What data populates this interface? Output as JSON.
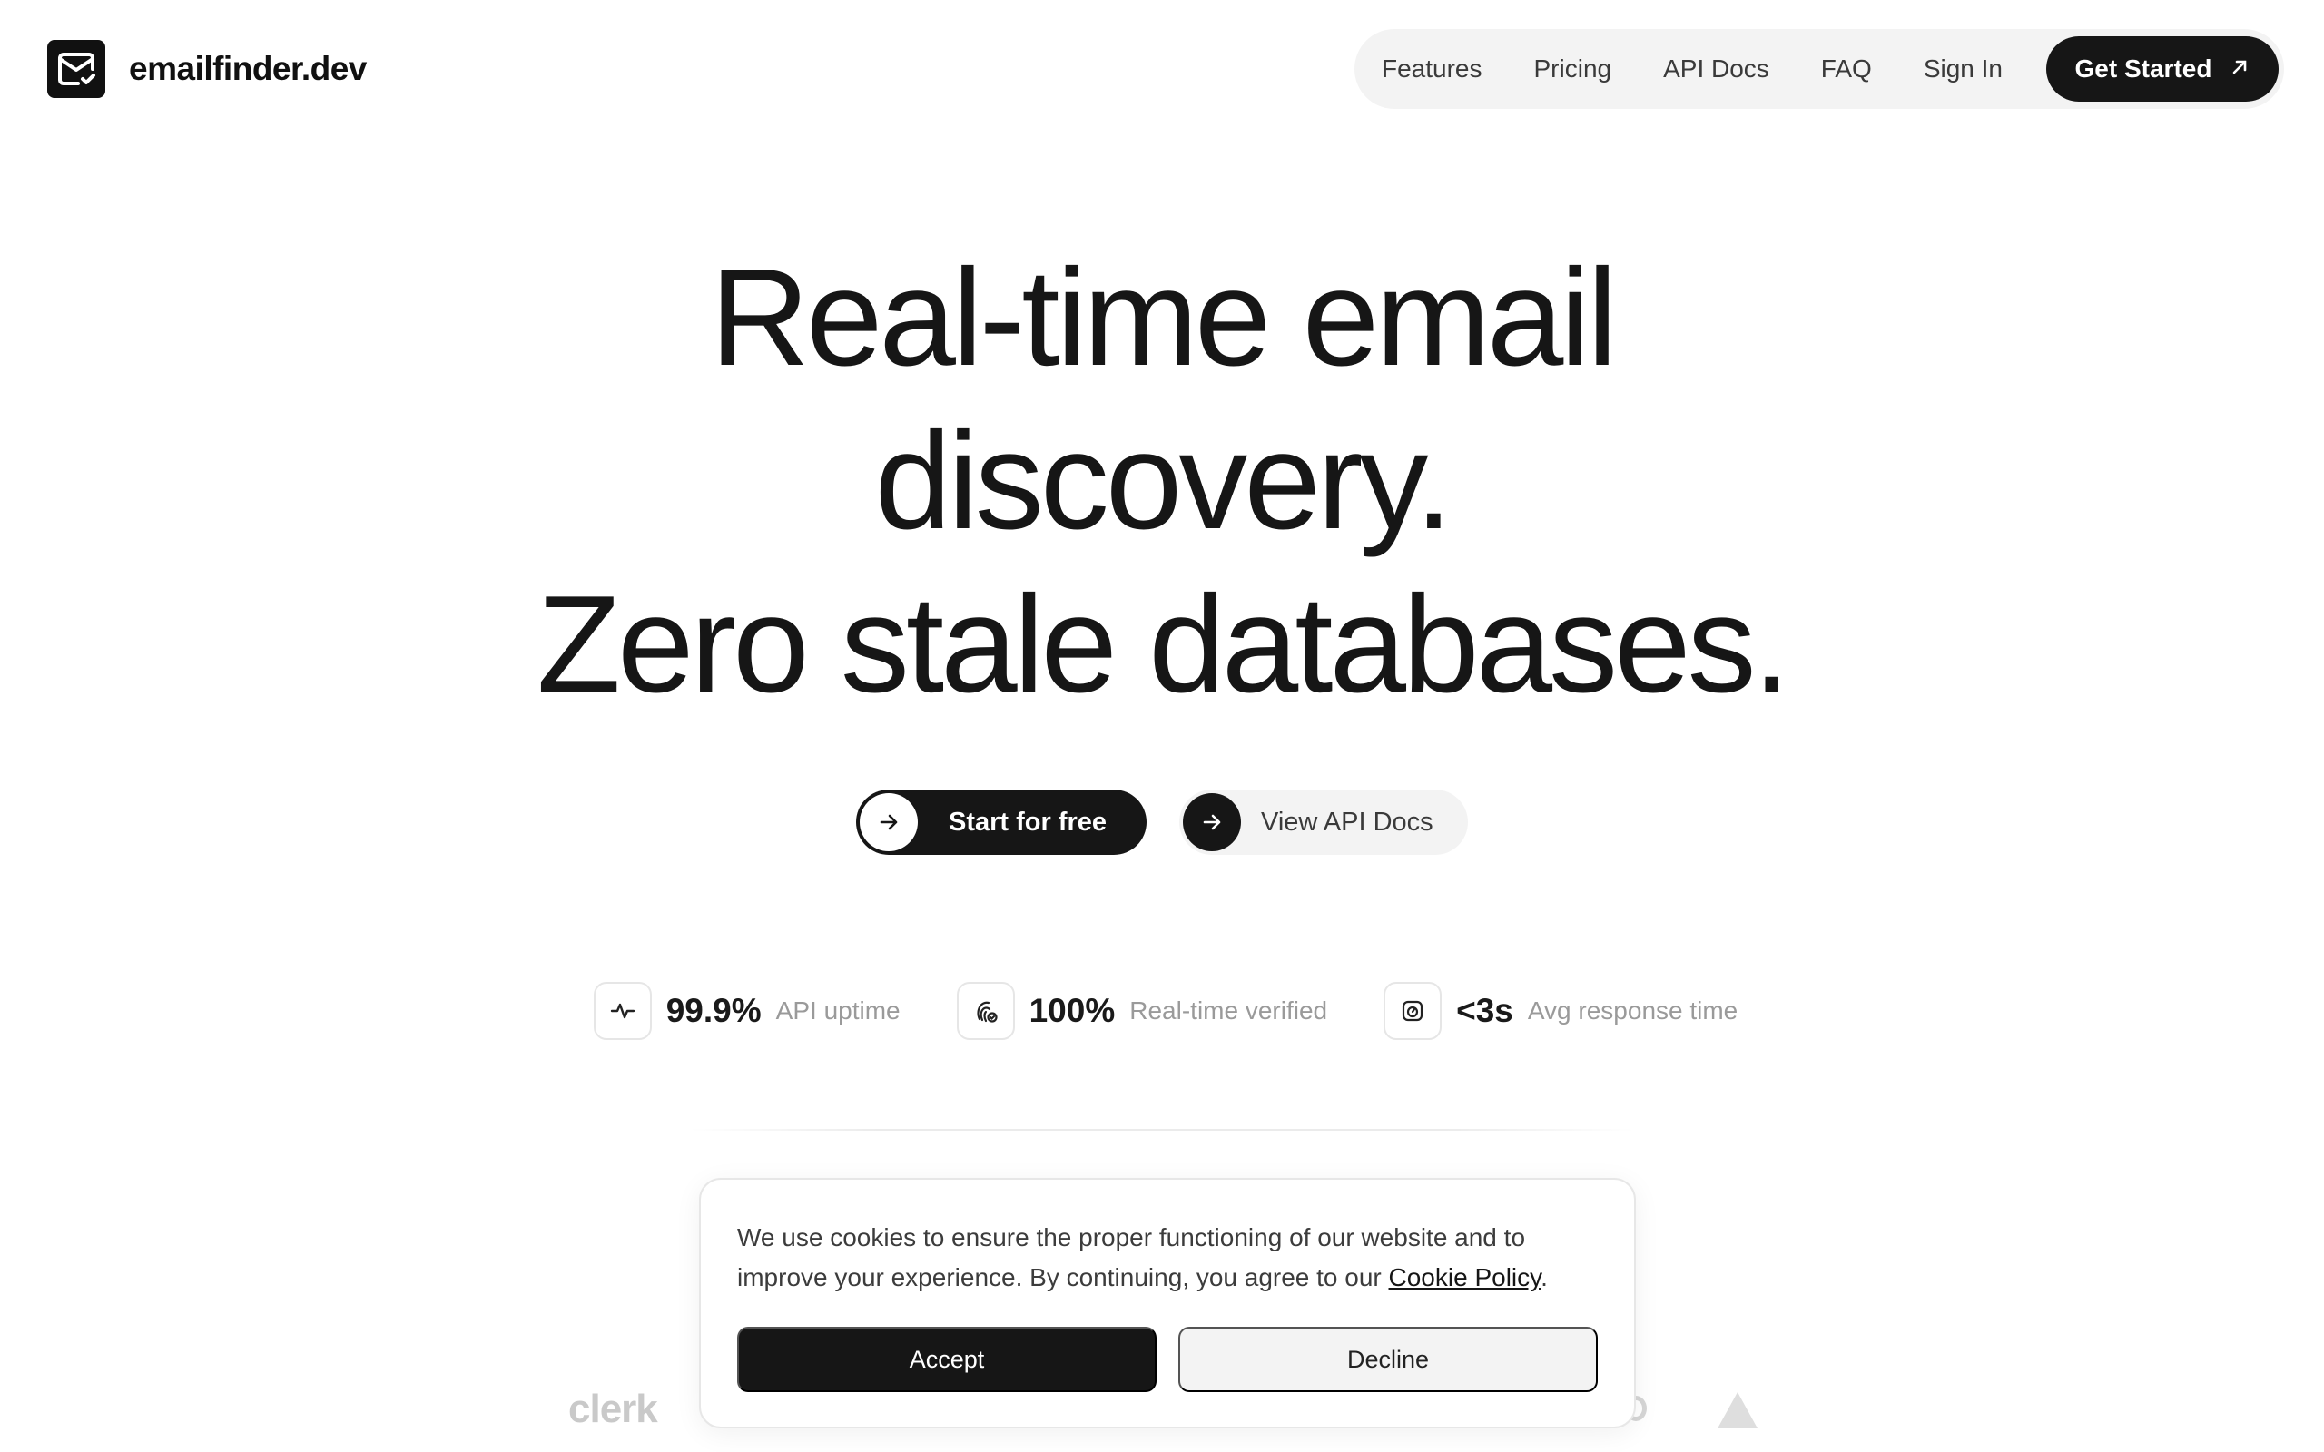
{
  "header": {
    "brand": "emailfinder.dev",
    "nav": [
      {
        "label": "Features"
      },
      {
        "label": "Pricing"
      },
      {
        "label": "API Docs"
      },
      {
        "label": "FAQ"
      },
      {
        "label": "Sign In"
      }
    ],
    "cta_label": "Get Started"
  },
  "hero": {
    "line1": "Real-time email",
    "line2": "discovery.",
    "line3": "Zero stale databases."
  },
  "cta": {
    "primary_label": "Start for free",
    "secondary_label": "View API Docs"
  },
  "stats": [
    {
      "value": "99.9%",
      "label": "API uptime",
      "icon": "activity-icon"
    },
    {
      "value": "100%",
      "label": "Real-time verified",
      "icon": "fingerprint-icon"
    },
    {
      "value": "<3s",
      "label": "Avg response time",
      "icon": "timer-icon"
    }
  ],
  "brands": {
    "clerk": "clerk"
  },
  "cookie": {
    "text_before": "We use cookies to ensure the proper functioning of our website and to improve your experience. By continuing, you agree to our ",
    "link_label": "Cookie Policy",
    "text_after": ".",
    "accept_label": "Accept",
    "decline_label": "Decline"
  }
}
